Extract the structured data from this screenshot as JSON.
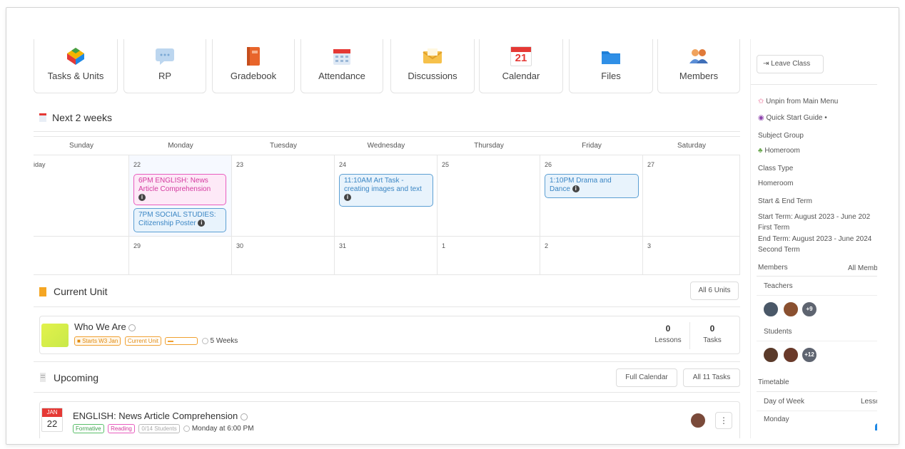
{
  "tools": [
    {
      "label": "Tasks & Units",
      "icon": "tasks-units-icon"
    },
    {
      "label": "RP",
      "icon": "chat-bubble-icon"
    },
    {
      "label": "Gradebook",
      "icon": "gradebook-icon"
    },
    {
      "label": "Attendance",
      "icon": "attendance-icon"
    },
    {
      "label": "Discussions",
      "icon": "envelope-icon"
    },
    {
      "label": "Calendar",
      "icon": "calendar-icon",
      "badge": "21"
    },
    {
      "label": "Files",
      "icon": "folder-icon"
    },
    {
      "label": "Members",
      "icon": "members-icon"
    }
  ],
  "next_weeks": {
    "title": "Next 2 weeks",
    "days": [
      "Sunday",
      "Monday",
      "Tuesday",
      "Wednesday",
      "Thursday",
      "Friday",
      "Saturday"
    ],
    "week1": [
      "iday",
      "22",
      "23",
      "24",
      "25",
      "26",
      "27"
    ],
    "week2": [
      "",
      "29",
      "30",
      "31",
      "1",
      "2",
      "3"
    ],
    "events": {
      "mon1": "6PM ENGLISH: News Article Comprehension",
      "mon2": "7PM SOCIAL STUDIES: Citizenship Poster",
      "wed1": "11:10AM Art Task - creating images and text",
      "fri1": "1:10PM Drama and Dance"
    }
  },
  "current_unit": {
    "title": "Current Unit",
    "all_units": "All 6 Units",
    "unit_name": "Who We Are",
    "chips": [
      "Starts W3 Jan",
      "Current Unit"
    ],
    "duration": "5 Weeks",
    "lessons_count": "0",
    "lessons_label": "Lessons",
    "tasks_count": "0",
    "tasks_label": "Tasks"
  },
  "upcoming": {
    "title": "Upcoming",
    "full_calendar": "Full Calendar",
    "all_tasks": "All 11 Tasks",
    "item": {
      "month": "JAN",
      "day": "22",
      "title": "ENGLISH: News Article Comprehension",
      "chips": [
        "Formative",
        "Reading",
        "0/14 Students"
      ],
      "when": "Monday at 6:00 PM",
      "more": "⋮"
    }
  },
  "sidebar": {
    "leave_class": "Leave Class",
    "unpin": "Unpin from Main Menu",
    "quick_start": "Quick Start Guide",
    "subject_group_label": "Subject Group",
    "subject_group_value": "Homeroom",
    "class_type_label": "Class Type",
    "class_type_value": "Homeroom",
    "term_label": "Start & End Term",
    "start_term": "Start Term: August 2023 - June 202",
    "start_term_name": "First Term",
    "end_term": "End Term: August 2023 - June 2024",
    "end_term_name": "Second Term",
    "members_label": "Members",
    "all_members": "All Memb",
    "teachers_label": "Teachers",
    "teachers_more": "+9",
    "students_label": "Students",
    "students_more": "+12",
    "timetable_label": "Timetable",
    "timetable_col1": "Day of Week",
    "timetable_col2": "Lesso",
    "timetable_row1": "Monday"
  },
  "colors": {
    "pink_event": "#e85dbf",
    "blue_event": "#5c9fd3",
    "unit_swatch": "#d8ee4b",
    "calendar_red": "#e53935"
  }
}
